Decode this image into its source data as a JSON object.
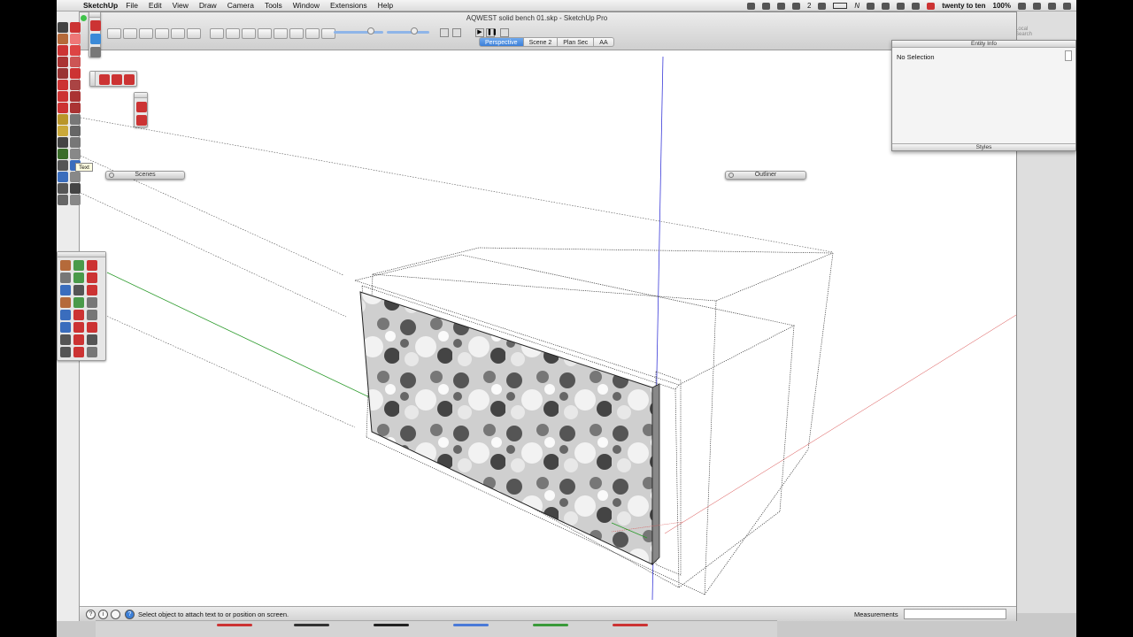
{
  "menubar": {
    "app_name": "SketchUp",
    "menus": [
      "File",
      "Edit",
      "View",
      "Draw",
      "Camera",
      "Tools",
      "Window",
      "Extensions",
      "Help"
    ],
    "status_number": "2",
    "clock": "twenty to ten",
    "battery": "100%",
    "letter_n": "N"
  },
  "window": {
    "title": "AQWEST solid bench 01.skp - SketchUp Pro"
  },
  "scene_tabs": [
    {
      "label": "Perspective",
      "active": true
    },
    {
      "label": "Scene 2",
      "active": false
    },
    {
      "label": "Plan Sec",
      "active": false
    },
    {
      "label": "AA",
      "active": false
    }
  ],
  "tooltip": "Text",
  "float_panels": {
    "scenes": "Scenes",
    "outliner": "Outliner"
  },
  "entity_info": {
    "title": "Entity Info",
    "selection": "No Selection",
    "footer": "Styles"
  },
  "behind_panel": {
    "label_1": "Local",
    "label_2": "Search"
  },
  "statusbar": {
    "message": "Select object to attach text to or position on screen.",
    "measurements_label": "Measurements",
    "measurements_value": ""
  },
  "colors": {
    "accent_blue": "#3b7fd8",
    "green_axis": "#2a9a2a",
    "blue_axis": "#3a3ad8",
    "red_axis": "#d84a4a"
  }
}
